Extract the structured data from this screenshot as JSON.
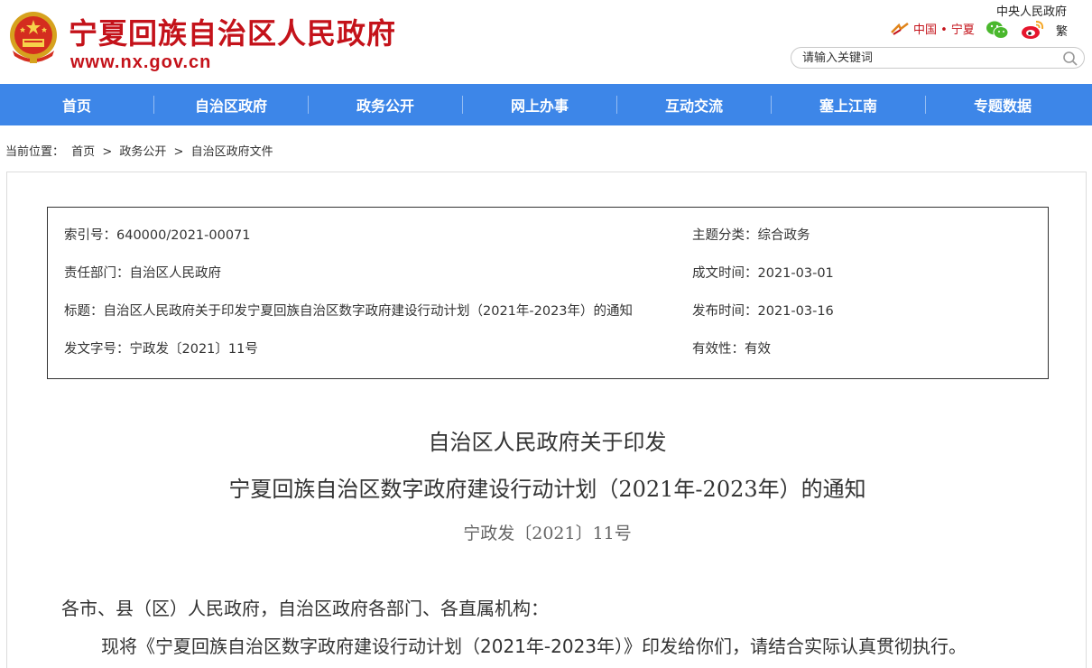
{
  "header": {
    "site_title": "宁夏回族自治区人民政府",
    "site_url": "www.nx.gov.cn",
    "top_link": "中央人民政府",
    "region_link": "中国 • 宁夏",
    "traditional": "繁",
    "search_placeholder": "请输入关键词"
  },
  "nav": {
    "items": [
      {
        "label": "首页"
      },
      {
        "label": "自治区政府"
      },
      {
        "label": "政务公开"
      },
      {
        "label": "网上办事"
      },
      {
        "label": "互动交流"
      },
      {
        "label": "塞上江南"
      },
      {
        "label": "专题数据"
      }
    ]
  },
  "breadcrumb": {
    "prefix": "当前位置：",
    "items": [
      "首页",
      "政务公开",
      "自治区政府文件"
    ],
    "sep": ">"
  },
  "meta": {
    "index_label": "索引号：",
    "index_value": "640000/2021-00071",
    "topic_label": "主题分类：",
    "topic_value": "综合政务",
    "dept_label": "责任部门：",
    "dept_value": "自治区人民政府",
    "date_label": "成文时间：",
    "date_value": "2021-03-01",
    "title_label": "标题：",
    "title_value": "自治区人民政府关于印发宁夏回族自治区数字政府建设行动计划（2021年-2023年）的通知",
    "publish_label": "发布时间：",
    "publish_value": "2021-03-16",
    "docno_label": "发文字号：",
    "docno_value": "宁政发〔2021〕11号",
    "validity_label": "有效性：",
    "validity_value": "有效"
  },
  "document": {
    "title_line1": "自治区人民政府关于印发",
    "title_line2": "宁夏回族自治区数字政府建设行动计划（2021年-2023年）的通知",
    "doc_number": "宁政发〔2021〕11号",
    "para1": "各市、县（区）人民政府，自治区政府各部门、各直属机构：",
    "para2": "现将《宁夏回族自治区数字政府建设行动计划（2021年-2023年）》印发给你们，请结合实际认真贯彻执行。"
  },
  "colors": {
    "brand_red": "#c4121a",
    "nav_blue": "#3d86e8"
  }
}
